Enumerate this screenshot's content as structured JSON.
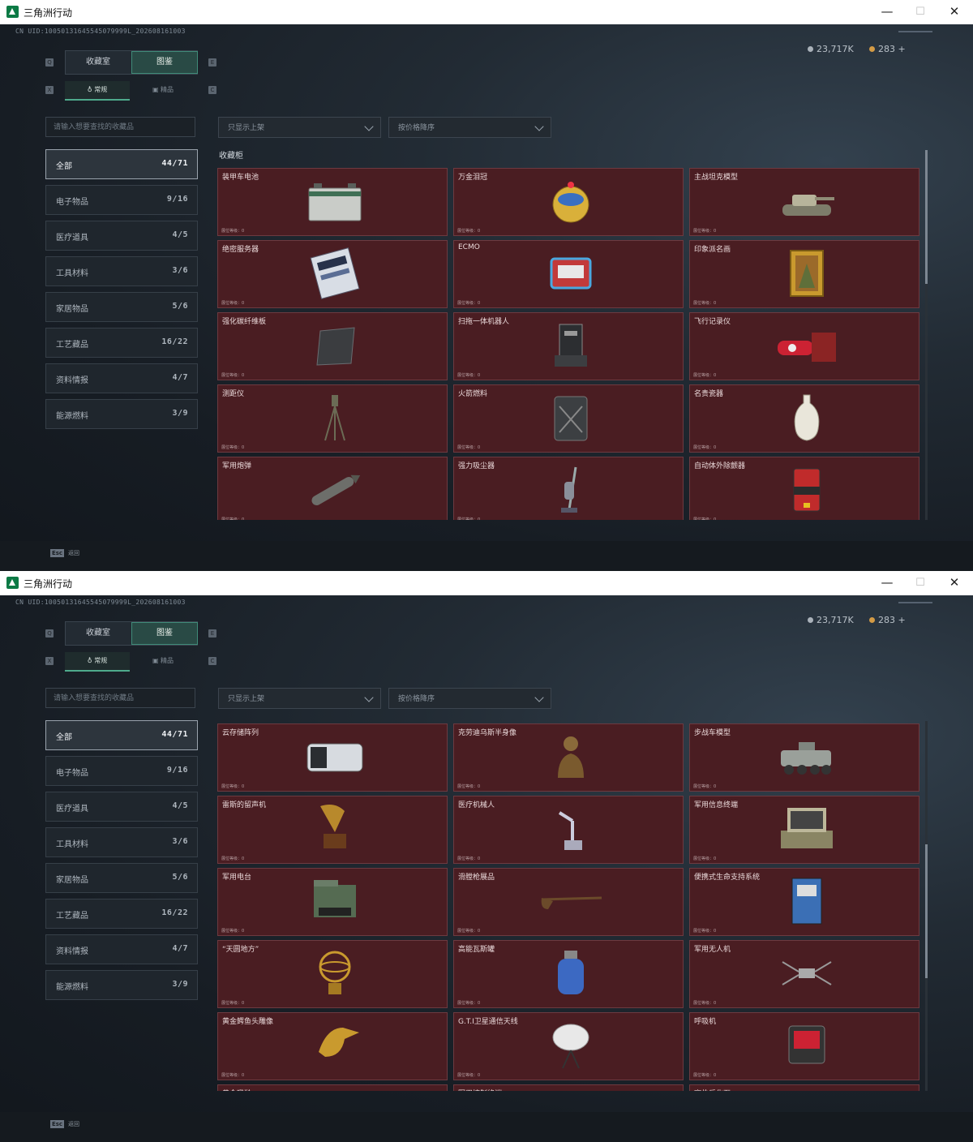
{
  "window": {
    "title": "三角洲行动",
    "min": "—",
    "max": "☐",
    "close": "✕"
  },
  "uid": "CN UID:10050131645545079999L_202608161003",
  "currency": {
    "silver": "23,717K",
    "gold": "283 +"
  },
  "hotkeys": {
    "q": "Q",
    "e": "E",
    "x": "X",
    "c": "C"
  },
  "tabs": {
    "collection_room": "收藏室",
    "catalog": "图鉴"
  },
  "subtabs": {
    "normal": "常规",
    "other": "精品"
  },
  "search": {
    "placeholder": "请输入想要查找的收藏品"
  },
  "filters": {
    "listed_only": "只显示上架",
    "sort": "按价格降序"
  },
  "categories": [
    {
      "name": "全部",
      "count": "44/71"
    },
    {
      "name": "电子物品",
      "count": "9/16"
    },
    {
      "name": "医疗道具",
      "count": "4/5"
    },
    {
      "name": "工具材料",
      "count": "3/6"
    },
    {
      "name": "家居物品",
      "count": "5/6"
    },
    {
      "name": "工艺藏品",
      "count": "16/22"
    },
    {
      "name": "资料情报",
      "count": "4/7"
    },
    {
      "name": "能源燃料",
      "count": "3/9"
    }
  ],
  "section_label": "收藏柜",
  "level_label": "展位等级：0",
  "items_view1": [
    "装甲车电池",
    "万金泪冠",
    "主战坦克模型",
    "绝密服务器",
    "ECMO",
    "印象派名画",
    "强化碳纤维板",
    "扫拖一体机器人",
    "飞行记录仪",
    "测距仪",
    "火箭燃料",
    "名贵瓷器",
    "军用炮弹",
    "强力吸尘器",
    "自动体外除颤器"
  ],
  "items_view2": [
    "云存储阵列",
    "克劳迪乌斯半身像",
    "步战车模型",
    "雷斯的留声机",
    "医疗机械人",
    "军用信息终端",
    "军用电台",
    "滑膛枪展品",
    "便携式生命支持系统",
    "“天圆地方”",
    "高能瓦斯罐",
    "军用无人机",
    "黄金鳄鱼头雕像",
    "G.T.I卫星通信天线",
    "呼吸机",
    "黄金瞪羚",
    "军用控制终端",
    "赛伯乐化石"
  ],
  "icon_names_view1": [
    "battery-icon",
    "crown-egg-icon",
    "tank-model-icon",
    "server-icon",
    "ecmo-icon",
    "painting-icon",
    "carbon-plate-icon",
    "robot-mop-icon",
    "flight-recorder-icon",
    "rangefinder-icon",
    "fuel-can-icon",
    "porcelain-vase-icon",
    "shell-icon",
    "vacuum-icon",
    "defibrillator-icon"
  ],
  "icon_names_view2": [
    "storage-array-icon",
    "bust-icon",
    "ifv-model-icon",
    "gramophone-icon",
    "medical-robot-icon",
    "rugged-terminal-icon",
    "radio-icon",
    "musket-icon",
    "life-support-icon",
    "armillary-sphere-icon",
    "gas-canister-icon",
    "drone-icon",
    "croc-head-statue-icon",
    "satellite-dish-icon",
    "ventilator-icon",
    "gazelle-icon",
    "control-terminal-icon",
    "fossil-icon"
  ],
  "esc": {
    "key": "Esc",
    "label": "返回"
  },
  "colors": {
    "card_bg": "#4a1d22",
    "accent": "#3f8a78",
    "silver_coin": "#aab2ba",
    "gold_coin": "#d49b45"
  }
}
